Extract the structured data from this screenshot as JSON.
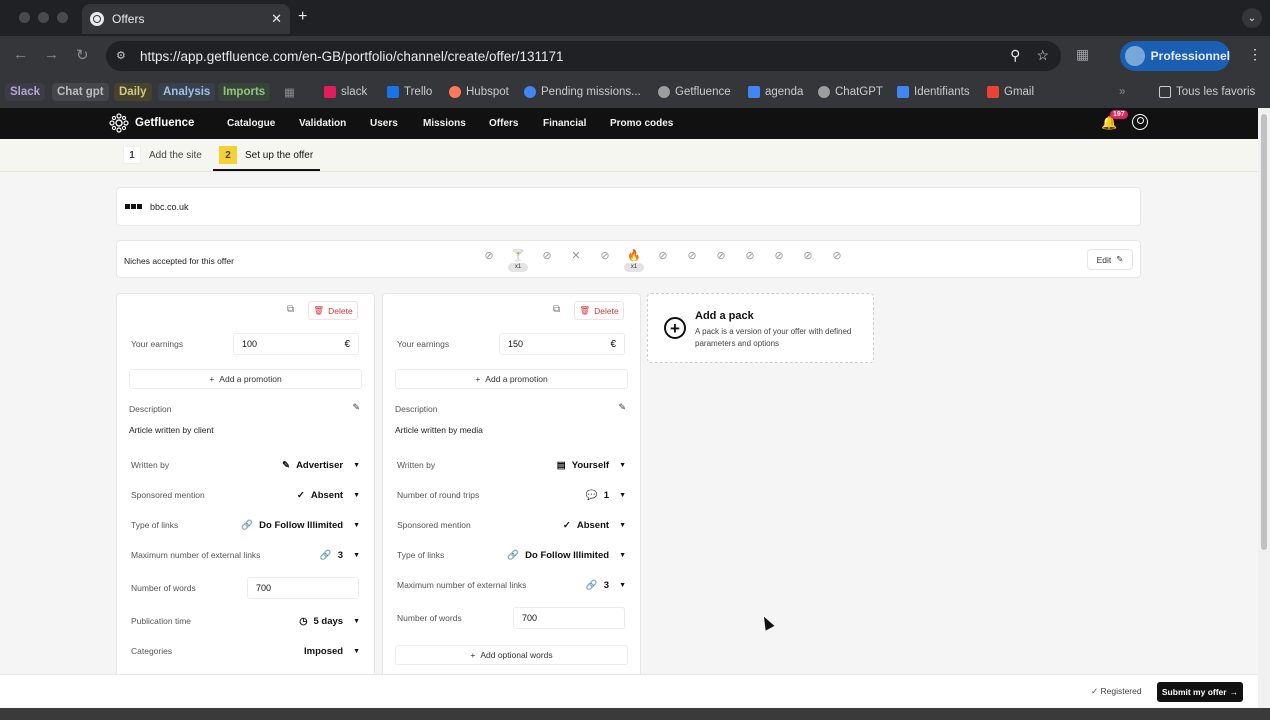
{
  "browser": {
    "tab_title": "Offers",
    "tab_close": "✕",
    "new_tab": "+",
    "url": "https://app.getfluence.com/en-GB/portfolio/channel/create/offer/131171",
    "profile_label": "Professionnel"
  },
  "bookmarks": {
    "items": [
      {
        "label": "Slack",
        "color": "#8e7cc3"
      },
      {
        "label": "Chat gpt",
        "color": "#9e9e9e"
      },
      {
        "label": "Daily",
        "color": "#c9b458"
      },
      {
        "label": "Analysis",
        "color": "#6c8ebf"
      },
      {
        "label": "Imports",
        "color": "#6aa84f"
      },
      {
        "label": "slack"
      },
      {
        "label": "Trello"
      },
      {
        "label": "Hubspot"
      },
      {
        "label": "Pending missions..."
      },
      {
        "label": "Getfluence"
      },
      {
        "label": "agenda"
      },
      {
        "label": "ChatGPT"
      },
      {
        "label": "Identifiants"
      },
      {
        "label": "Gmail"
      }
    ],
    "overflow": "»",
    "all_favorites": "Tous les favoris"
  },
  "app": {
    "brand": "Getfluence",
    "nav": [
      "Catalogue",
      "Validation",
      "Users",
      "Missions",
      "Offers",
      "Financial",
      "Promo codes"
    ],
    "notification_count": "197",
    "accent": "#f5d036"
  },
  "steps": [
    {
      "num": "1",
      "label": "Add the site"
    },
    {
      "num": "2",
      "label": "Set up the offer"
    }
  ],
  "site": {
    "domain": "bbc.co.uk"
  },
  "niches": {
    "label": "Niches accepted for this offer",
    "counts": [
      "x1",
      "x1"
    ],
    "edit_label": "Edit"
  },
  "packs": [
    {
      "delete_label": "Delete",
      "earnings_label": "Your earnings",
      "earnings_value": "100",
      "currency": "€",
      "promo_label": "Add a promotion",
      "description_label": "Description",
      "description_text": "Article written by client",
      "rows": [
        {
          "label": "Written by",
          "value": "Advertiser"
        },
        {
          "label": "Sponsored mention",
          "value": "Absent"
        },
        {
          "label": "Type of links",
          "value": "Do Follow Illimited"
        },
        {
          "label": "Maximum number of external links",
          "value": "3"
        }
      ],
      "words_label": "Number of words",
      "words_value": "700",
      "rows2": [
        {
          "label": "Publication time",
          "value": "5 days"
        },
        {
          "label": "Categories",
          "value": "Imposed"
        }
      ]
    },
    {
      "delete_label": "Delete",
      "earnings_label": "Your earnings",
      "earnings_value": "150",
      "currency": "€",
      "promo_label": "Add a promotion",
      "description_label": "Description",
      "description_text": "Article written by media",
      "rows": [
        {
          "label": "Written by",
          "value": "Yourself"
        },
        {
          "label": "Number of round trips",
          "value": "1"
        },
        {
          "label": "Sponsored mention",
          "value": "Absent"
        },
        {
          "label": "Type of links",
          "value": "Do Follow Illimited"
        },
        {
          "label": "Maximum number of external links",
          "value": "3"
        }
      ],
      "words_label": "Number of words",
      "words_value": "700",
      "optional_words_label": "Add optional words"
    }
  ],
  "add_pack": {
    "title": "Add a pack",
    "subtitle": "A pack is a version of your offer with defined parameters and options"
  },
  "footer": {
    "registered": "Registered",
    "submit": "Submit my offer"
  }
}
